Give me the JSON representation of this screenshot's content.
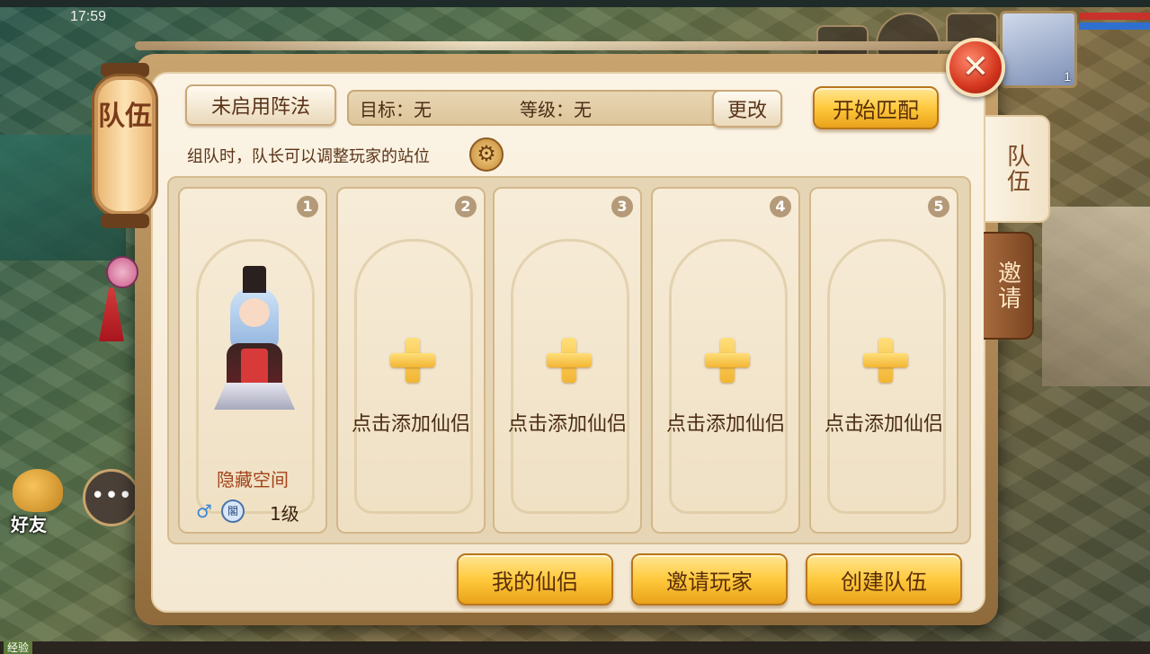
{
  "status": {
    "time": "17:59"
  },
  "hud": {
    "player_level": "1",
    "friends_label": "好友",
    "chat_icon_label": "•••",
    "exp_label": "经验"
  },
  "lantern": {
    "title": "队伍"
  },
  "close": {
    "label": "✕"
  },
  "tabs": [
    {
      "label": "队伍",
      "active": true
    },
    {
      "label": "邀请",
      "active": false
    }
  ],
  "toolbar": {
    "formation_label": "未启用阵法",
    "target_text": "目标：无",
    "level_text": "等级：无",
    "change_label": "更改",
    "start_label": "开始匹配"
  },
  "hint": {
    "text": "组队时，队长可以调整玩家的站位",
    "gear_icon": "⚙"
  },
  "slots": [
    {
      "number": "1",
      "occupied": true,
      "name": "隐藏空间",
      "gender_icon": "♂",
      "sect_icon": "閣",
      "level": "1级"
    },
    {
      "number": "2",
      "occupied": false,
      "add_label": "点击添加仙侣"
    },
    {
      "number": "3",
      "occupied": false,
      "add_label": "点击添加仙侣"
    },
    {
      "number": "4",
      "occupied": false,
      "add_label": "点击添加仙侣"
    },
    {
      "number": "5",
      "occupied": false,
      "add_label": "点击添加仙侣"
    }
  ],
  "footer": {
    "my_partner_label": "我的仙侣",
    "invite_label": "邀请玩家",
    "create_team_label": "创建队伍"
  },
  "colors": {
    "panel_bg": "#fbf3e4",
    "gold_button": "#ffc93c",
    "close_red": "#d3351d",
    "text_brown": "#5a3418",
    "name_red": "#a3431b"
  }
}
